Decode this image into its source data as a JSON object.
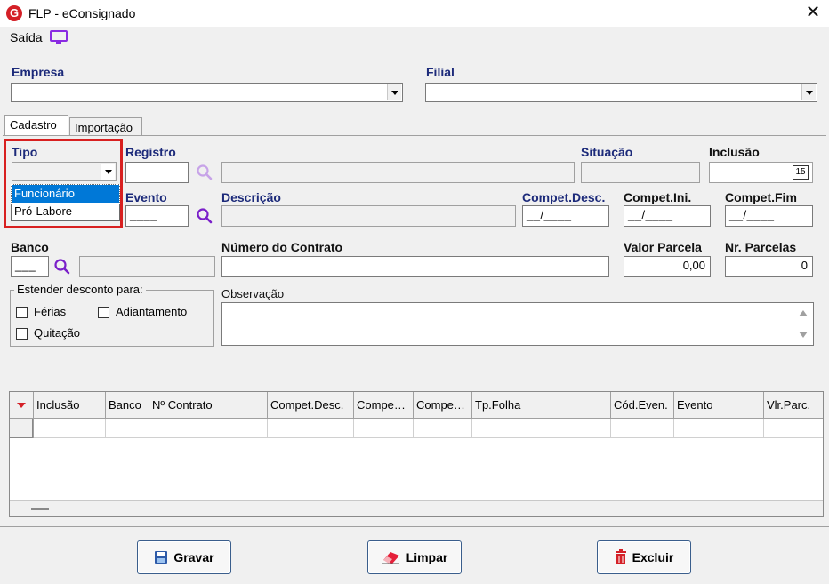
{
  "window": {
    "title": "FLP - eConsignado",
    "logo_letter": "G"
  },
  "menu": {
    "saida_label": "Saída"
  },
  "empresa": {
    "label": "Empresa",
    "value": ""
  },
  "filial": {
    "label": "Filial",
    "value": ""
  },
  "tabs": [
    {
      "label": "Cadastro",
      "active": true
    },
    {
      "label": "Importação",
      "active": false
    }
  ],
  "form": {
    "tipo_label": "Tipo",
    "tipo_options": [
      "Funcionário",
      "Pró-Labore"
    ],
    "tipo_selected_index": 0,
    "registro_label": "Registro",
    "situacao_label": "Situação",
    "inclusao_label": "Inclusão",
    "inclusao_calendar_text": "15",
    "evento_label": "Evento",
    "evento_value": "____",
    "descricao_label": "Descrição",
    "compet_desc_label": "Compet.Desc.",
    "compet_desc_value": "__/____",
    "compet_ini_label": "Compet.Ini.",
    "compet_ini_value": "__/____",
    "compet_fim_label": "Compet.Fim",
    "compet_fim_value": "__/____",
    "banco_label": "Banco",
    "banco_value": "___",
    "numero_contrato_label": "Número do Contrato",
    "valor_parcela_label": "Valor Parcela",
    "valor_parcela_value": "0,00",
    "nr_parcelas_label": "Nr. Parcelas",
    "nr_parcelas_value": "0",
    "estender_label": "Estender desconto para:",
    "ferias_label": "Férias",
    "adiantamento_label": "Adiantamento",
    "quitacao_label": "Quitação",
    "observacao_label": "Observação"
  },
  "grid": {
    "columns": [
      "Inclusão",
      "Banco",
      "Nº Contrato",
      "Compet.Desc.",
      "Compe…",
      "Compe…",
      "Tp.Folha",
      "Cód.Even.",
      "Evento",
      "Vlr.Parc."
    ]
  },
  "buttons": {
    "gravar": "Gravar",
    "limpar": "Limpar",
    "excluir": "Excluir"
  },
  "colors": {
    "label_blue": "#1c2a7a",
    "selection": "#0078d7",
    "highlight_red": "#d82020",
    "search_purple": "#8a2be2"
  }
}
